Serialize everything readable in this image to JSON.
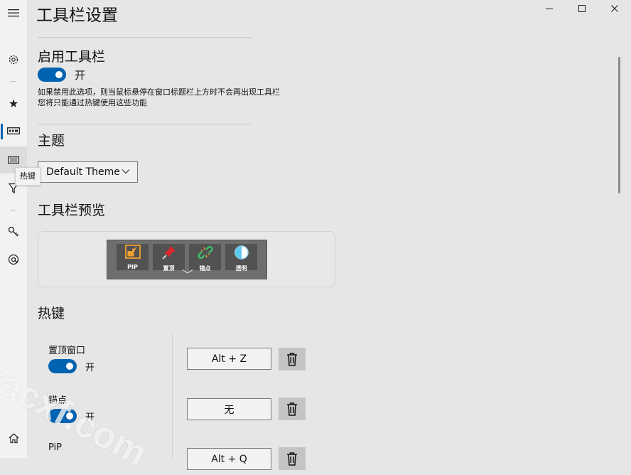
{
  "window": {
    "title": "工具栏设置",
    "controls": [
      "minimize",
      "maximize",
      "close"
    ]
  },
  "nav": {
    "items": [
      {
        "name": "menu",
        "icon": "hamburger-icon"
      },
      {
        "name": "settings",
        "icon": "gear-icon"
      },
      {
        "name": "favorites",
        "icon": "star-icon"
      },
      {
        "name": "toolbar",
        "icon": "toolbar-icon",
        "selected": true
      },
      {
        "name": "hotkeys",
        "icon": "keyboard-icon"
      },
      {
        "name": "filter",
        "icon": "filter-icon"
      },
      {
        "name": "keys",
        "icon": "key-icon"
      },
      {
        "name": "about",
        "icon": "at-icon"
      },
      {
        "name": "home",
        "icon": "home-icon"
      }
    ],
    "tooltip": "热键"
  },
  "enable_toolbar": {
    "heading": "启用工具栏",
    "toggle_label": "开",
    "toggle_on": true,
    "note_line1": "如果禁用此选项，则当鼠标悬停在窗口标题栏上方时不会再出现工具栏",
    "note_line2": "您将只能通过热键使用这些功能"
  },
  "theme": {
    "heading": "主题",
    "selected": "Default Theme"
  },
  "preview": {
    "heading": "工具栏预览",
    "buttons": [
      {
        "label": "PIP",
        "icon": "pip-icon"
      },
      {
        "label": "置顶",
        "icon": "pin-icon"
      },
      {
        "label": "锚点",
        "icon": "link-icon"
      },
      {
        "label": "透明",
        "icon": "transparency-icon"
      }
    ]
  },
  "hotkeys": {
    "heading": "热键",
    "items": [
      {
        "name": "置顶窗口",
        "toggle_label": "开",
        "key": "Alt + Z"
      },
      {
        "name": "锚点",
        "toggle_label": "开",
        "key": "无"
      },
      {
        "name": "PiP",
        "key": "Alt + Q"
      }
    ]
  },
  "watermark": "racxf.com",
  "colors": {
    "accent": "#0063b1",
    "background": "#e6e6e6",
    "rail": "#f2f2f2"
  }
}
